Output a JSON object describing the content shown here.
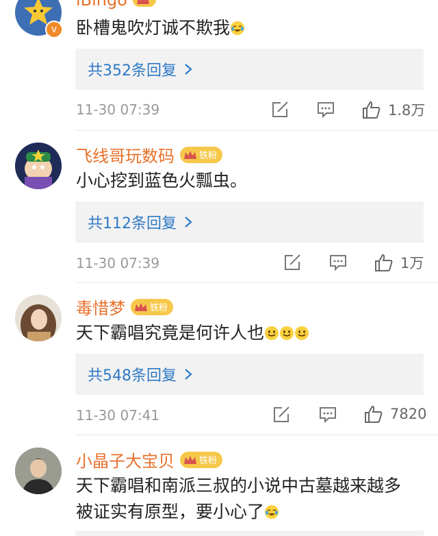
{
  "comments": [
    {
      "name": "iBingo",
      "badge": "",
      "text": "卧槽鬼吹灯诚不欺我",
      "emoji": [
        "laugh-cry"
      ],
      "replies": "共352条回复",
      "time": "11-30 07:39",
      "likes": "1.8万"
    },
    {
      "name": "飞线哥玩数码",
      "badge": "铁粉",
      "text": "小心挖到蓝色火瓢虫。",
      "emoji": [],
      "replies": "共112条回复",
      "time": "11-30 07:39",
      "likes": "1万"
    },
    {
      "name": "毒惜梦",
      "badge": "铁粉",
      "text": "天下霸唱究竟是何许人也",
      "emoji": [
        "smile",
        "smile",
        "smile"
      ],
      "replies": "共548条回复",
      "time": "11-30 07:41",
      "likes": "7820"
    },
    {
      "name": "小晶子大宝贝",
      "badge": "铁粉",
      "text_line1": "天下霸唱和南派三叔的小说中古墓越来越多",
      "text_line2": "被证实有原型，要小心了",
      "emoji": [
        "laugh-cry"
      ]
    }
  ],
  "colors": {
    "name": "#e8702a",
    "reply_link": "#2d79c7",
    "badge": "#f6c84a",
    "meta": "#999999"
  }
}
